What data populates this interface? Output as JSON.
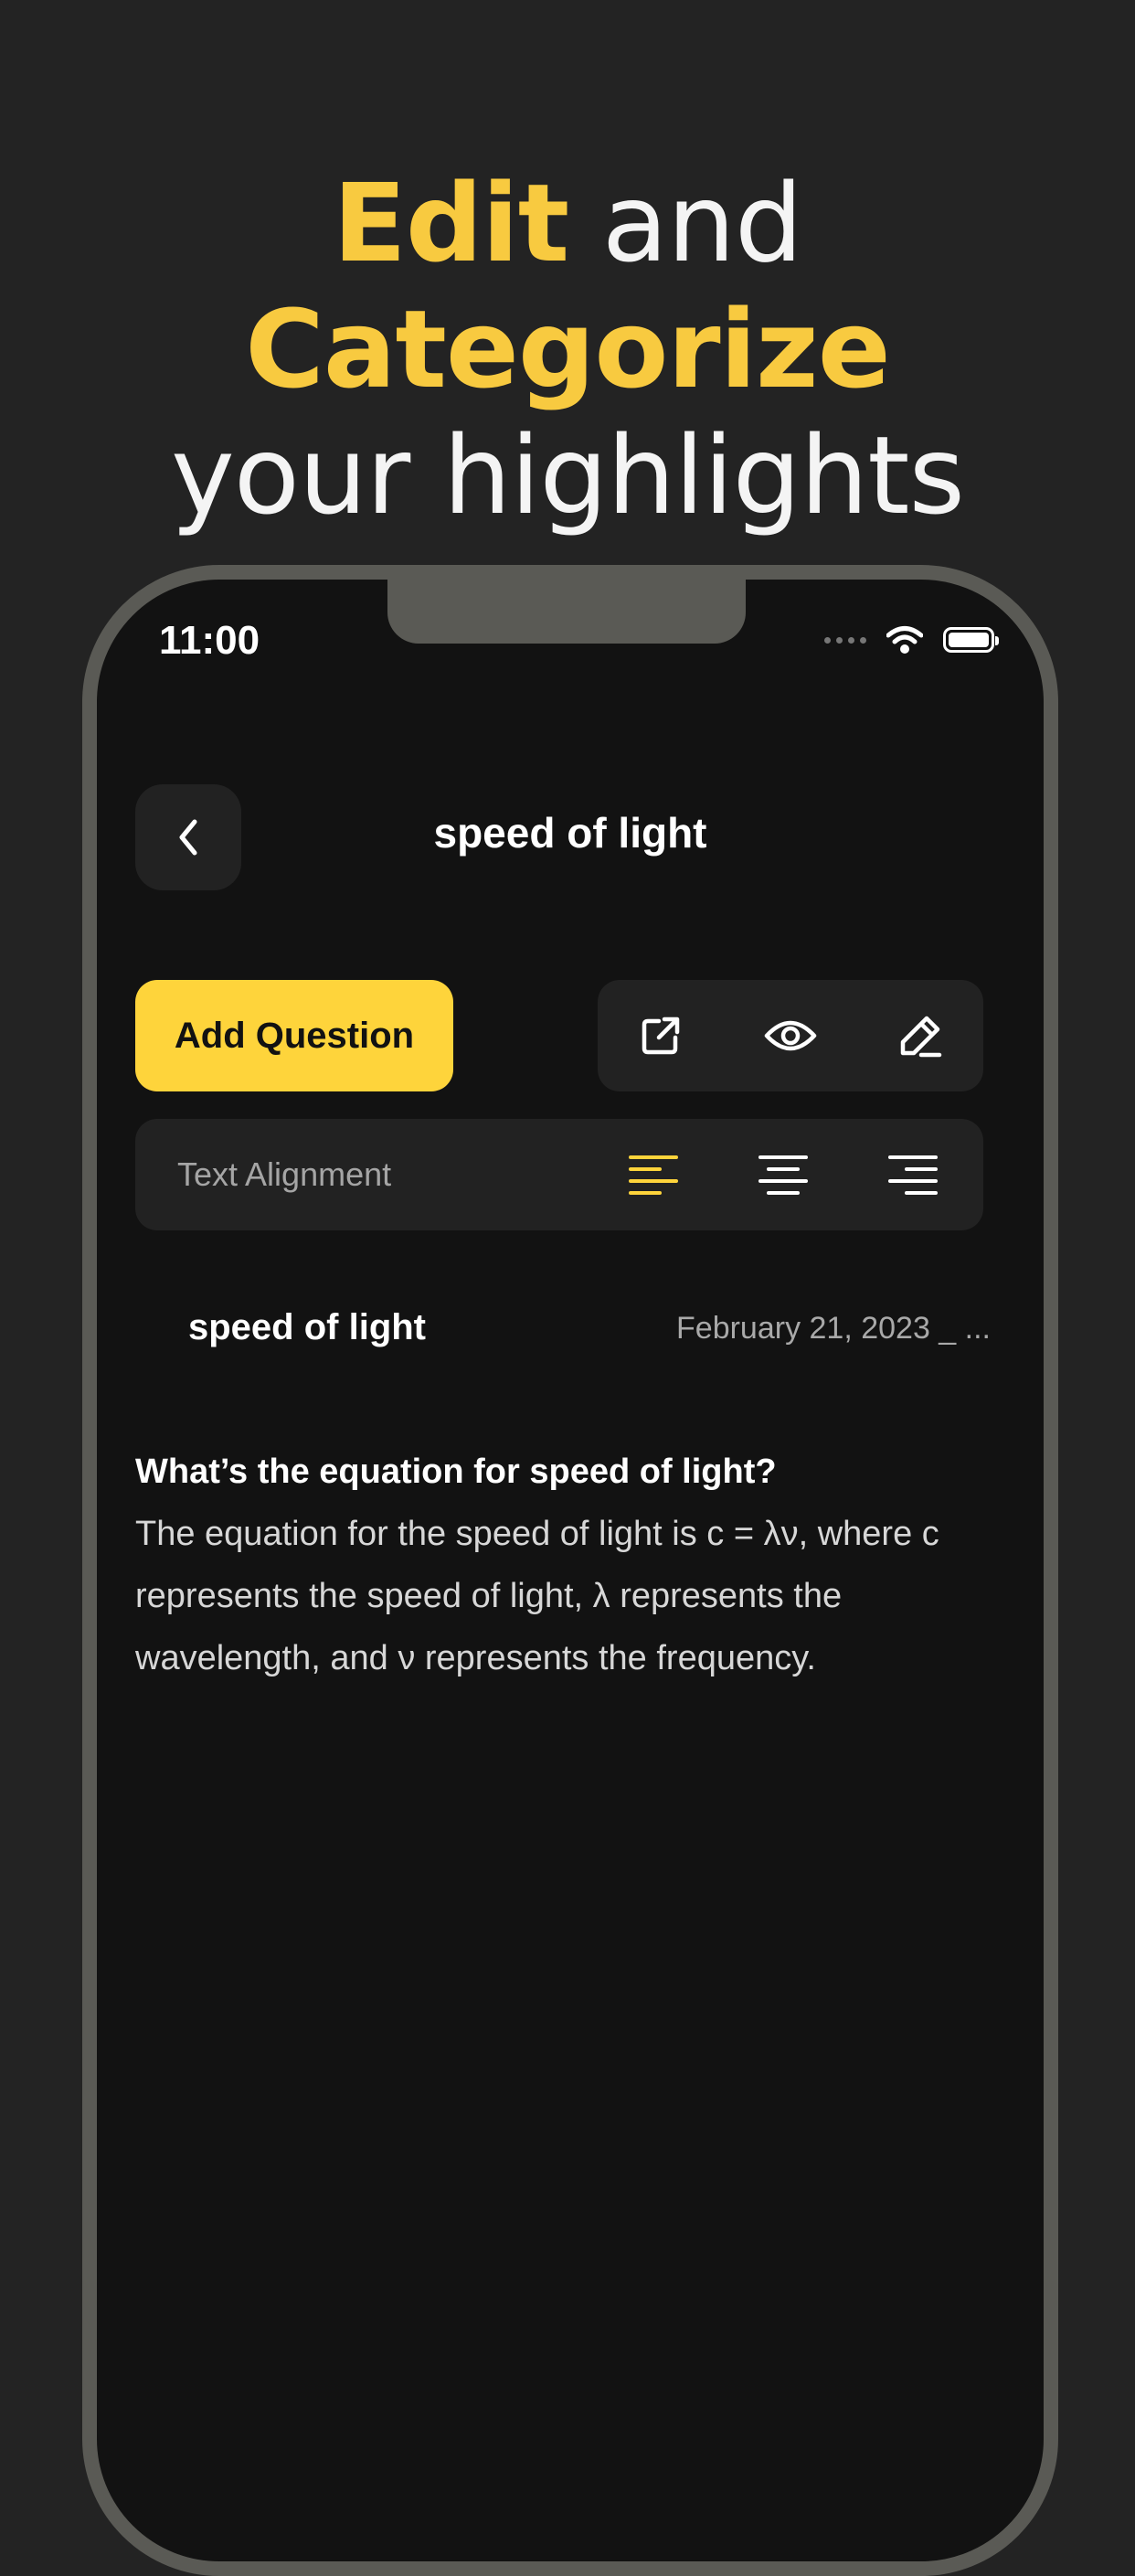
{
  "colors": {
    "page_bg": "#232323",
    "accent": "#fed43b",
    "headline_accent": "#f8ca40",
    "screen_bg": "#121212",
    "surface": "#222222"
  },
  "headline": {
    "word1": "Edit",
    "word2": "and",
    "word3": "Categorize",
    "line2": "your highlights"
  },
  "status_bar": {
    "time": "11:00",
    "icons": [
      "signal-dots-icon",
      "wifi-icon",
      "battery-icon"
    ]
  },
  "nav": {
    "back_icon": "chevron-left-icon",
    "title": "speed of light"
  },
  "toolbar": {
    "add_question_label": "Add Question",
    "actions": [
      "external-link-icon",
      "eye-icon",
      "edit-pencil-icon"
    ]
  },
  "alignment": {
    "label": "Text Alignment",
    "options": [
      "align-left-icon",
      "align-center-icon",
      "align-right-icon"
    ],
    "selected": "align-left-icon"
  },
  "note": {
    "title": "speed of light",
    "date": "February 21, 2023 _ ...",
    "question": "What’s the equation for speed of light?",
    "answer": "The equation for the speed of light is c = λν, where c represents the speed of light, λ represents the wavelength, and ν represents the frequency."
  }
}
